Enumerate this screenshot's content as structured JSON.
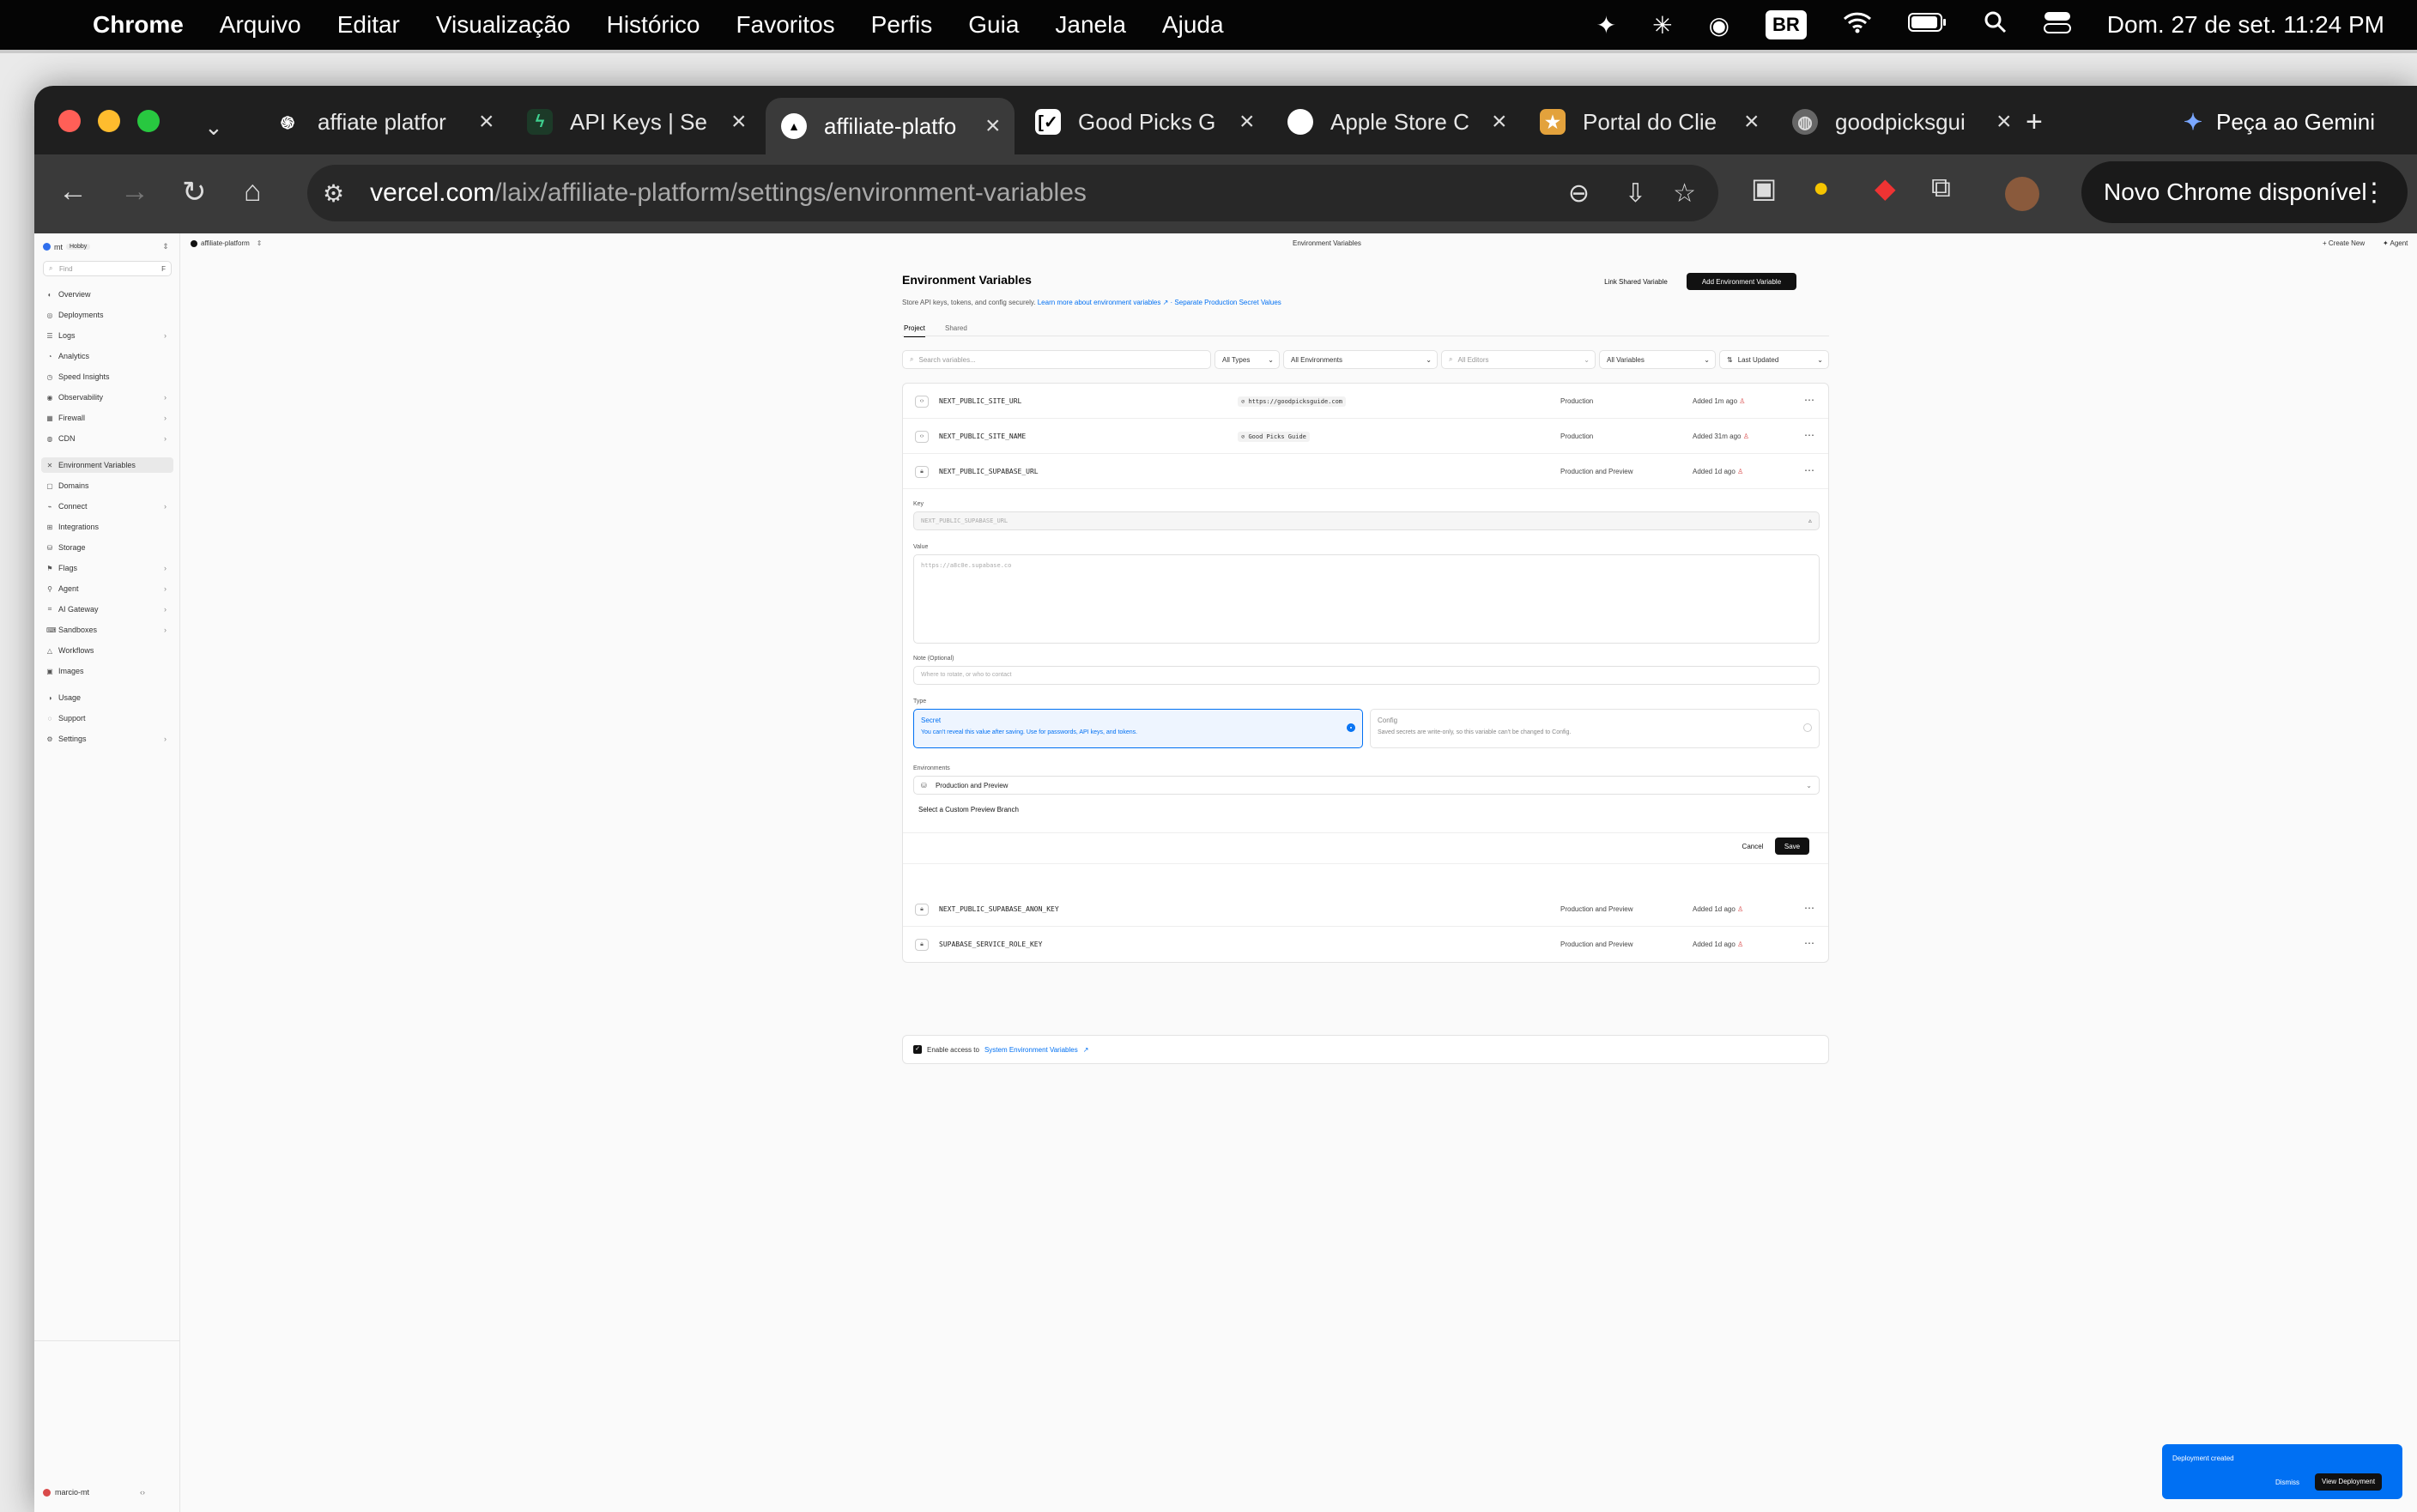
{
  "menubar": {
    "app": "Chrome",
    "items": [
      "Arquivo",
      "Editar",
      "Visualização",
      "Histórico",
      "Favoritos",
      "Perfis",
      "Guia",
      "Janela",
      "Ajuda"
    ],
    "keyboard": "BR",
    "datetime": "Dom. 27 de set.  11:24 PM"
  },
  "browser": {
    "tabs": [
      {
        "title": "affiate platfor",
        "icon": "openai-icon"
      },
      {
        "title": "API Keys | Se",
        "icon": "supabase-icon"
      },
      {
        "title": "affiliate-platfo",
        "icon": "vercel-icon",
        "active": true
      },
      {
        "title": "Good Picks G",
        "icon": "goodpicks-icon"
      },
      {
        "title": "Apple Store C",
        "icon": "apple-icon"
      },
      {
        "title": "Portal do Clie",
        "icon": "portal-icon"
      },
      {
        "title": "goodpicksgui",
        "icon": "globe-icon"
      }
    ],
    "gemini": "Peça ao Gemini",
    "url_host": "vercel.com",
    "url_path": "/laix/affiliate-platform/settings/environment-variables",
    "update_button": "Novo Chrome disponível"
  },
  "sidebar": {
    "team": "mt",
    "plan": "Hobby",
    "find_placeholder": "Find",
    "find_shortcut": "F",
    "items": [
      {
        "label": "Overview",
        "icon": "overview-icon"
      },
      {
        "label": "Deployments",
        "icon": "deployments-icon"
      },
      {
        "label": "Logs",
        "icon": "logs-icon",
        "chev": true
      },
      {
        "label": "Analytics",
        "icon": "analytics-icon"
      },
      {
        "label": "Speed Insights",
        "icon": "speed-icon"
      },
      {
        "label": "Observability",
        "icon": "observability-icon",
        "chev": true
      },
      {
        "label": "Firewall",
        "icon": "firewall-icon",
        "chev": true
      },
      {
        "label": "CDN",
        "icon": "cdn-icon",
        "chev": true
      },
      {
        "label": "Environment Variables",
        "icon": "env-icon",
        "active": true
      },
      {
        "label": "Domains",
        "icon": "domains-icon"
      },
      {
        "label": "Connect",
        "icon": "connect-icon",
        "chev": true
      },
      {
        "label": "Integrations",
        "icon": "integrations-icon"
      },
      {
        "label": "Storage",
        "icon": "storage-icon"
      },
      {
        "label": "Flags",
        "icon": "flags-icon",
        "chev": true
      },
      {
        "label": "Agent",
        "icon": "agent-icon",
        "chev": true
      },
      {
        "label": "AI Gateway",
        "icon": "ai-gateway-icon",
        "chev": true
      },
      {
        "label": "Sandboxes",
        "icon": "sandboxes-icon",
        "chev": true
      },
      {
        "label": "Workflows",
        "icon": "workflows-icon"
      },
      {
        "label": "Images",
        "icon": "images-icon"
      },
      {
        "label": "Usage",
        "icon": "usage-icon"
      },
      {
        "label": "Support",
        "icon": "support-icon"
      },
      {
        "label": "Settings",
        "icon": "settings-icon",
        "chev": true
      }
    ],
    "user": "marcio-mt"
  },
  "topbar": {
    "project": "affiliate-platform",
    "page_title": "Environment Variables",
    "create_new": "Create New",
    "agent": "Agent"
  },
  "content": {
    "title": "Environment Variables",
    "link_shared": "Link Shared Variable",
    "add_variable": "Add Environment Variable",
    "description": "Store API keys, tokens, and config securely.",
    "learn_more": "Learn more about environment variables",
    "separate_link": "· Separate Production Secret Values",
    "tabs": [
      "Project",
      "Shared"
    ],
    "search_placeholder": "Search variables...",
    "filters": {
      "types": "All Types",
      "environments": "All Environments",
      "editors": "All Editors",
      "variables": "All Variables",
      "sort": "Last Updated"
    },
    "rows": [
      {
        "key": "NEXT_PUBLIC_SITE_URL",
        "value": "https://goodpicksguide.com",
        "env": "Production",
        "added": "Added 1m ago"
      },
      {
        "key": "NEXT_PUBLIC_SITE_NAME",
        "value": "Good Picks Guide",
        "env": "Production",
        "added": "Added 31m ago"
      },
      {
        "key": "NEXT_PUBLIC_SUPABASE_URL",
        "value": "",
        "env": "Production and Preview",
        "added": "Added 1d ago"
      },
      {
        "key": "NEXT_PUBLIC_SUPABASE_ANON_KEY",
        "value": "",
        "env": "Production and Preview",
        "added": "Added 1d ago"
      },
      {
        "key": "SUPABASE_SERVICE_ROLE_KEY",
        "value": "",
        "env": "Production and Preview",
        "added": "Added 1d ago"
      }
    ],
    "editor": {
      "key_label": "Key",
      "key_value": "NEXT_PUBLIC_SUPABASE_URL",
      "value_label": "Value",
      "value_text": "https://a8c0e.supabase.co",
      "note_label": "Note (Optional)",
      "note_placeholder": "Where to rotate, or who to contact",
      "type_label": "Type",
      "secret_title": "Secret",
      "secret_desc": "You can't reveal this value after saving. Use for passwords, API keys, and tokens.",
      "config_title": "Config",
      "config_desc": "Saved secrets are write-only, so this variable can't be changed to Config.",
      "environments_label": "Environments",
      "environments_value": "Production and Preview",
      "custom_branch": "Select a Custom Preview Branch",
      "cancel": "Cancel",
      "save": "Save"
    },
    "system_env_prefix": "Enable access to",
    "system_env_link": "System Environment Variables"
  },
  "toast": {
    "message": "Deployment created",
    "dismiss": "Dismiss",
    "view": "View Deployment"
  },
  "colors": {
    "accent": "#0070f3",
    "dark": "#111111"
  }
}
